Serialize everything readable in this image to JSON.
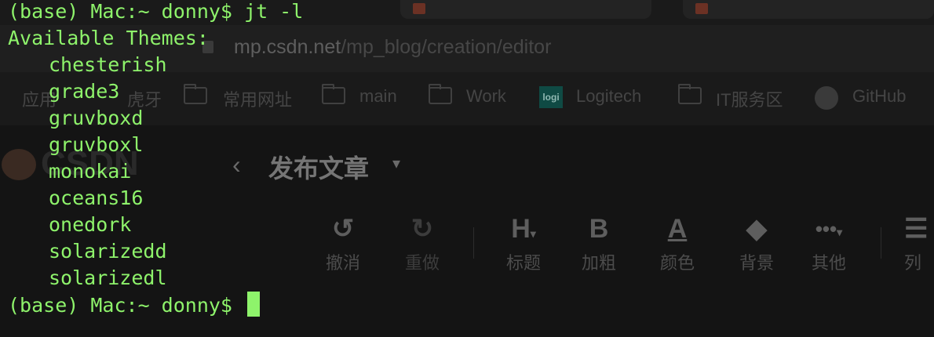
{
  "browser": {
    "url_host": "mp.csdn.net",
    "url_path": "/mp_blog/creation/editor",
    "bookmarks": [
      "应用",
      "虎牙",
      "常用网址",
      "main",
      "Work",
      "Logitech",
      "IT服务区",
      "GitHub"
    ],
    "logi_badge": "logi",
    "site_logo": "CSDN",
    "page_title": "发布文章",
    "toolbar": [
      {
        "icon": "undo-icon",
        "label": "撤消"
      },
      {
        "icon": "redo-icon",
        "label": "重做"
      },
      {
        "icon": "heading-icon",
        "label": "标题"
      },
      {
        "icon": "bold-icon",
        "label": "加粗"
      },
      {
        "icon": "text-color-icon",
        "label": "颜色"
      },
      {
        "icon": "paint-bucket-icon",
        "label": "背景"
      },
      {
        "icon": "more-icon",
        "label": "其他"
      },
      {
        "icon": "list-icon",
        "label": "列"
      }
    ]
  },
  "terminal": {
    "prompt": "(base) Mac:~ donny$ ",
    "command": "jt -l",
    "output_header": "Available Themes:",
    "themes": [
      "chesterish",
      "grade3",
      "gruvboxd",
      "gruvboxl",
      "monokai",
      "oceans16",
      "onedork",
      "solarizedd",
      "solarizedl"
    ],
    "final_prompt": "(base) Mac:~ donny$ ",
    "text_color": "#8ef36b"
  }
}
